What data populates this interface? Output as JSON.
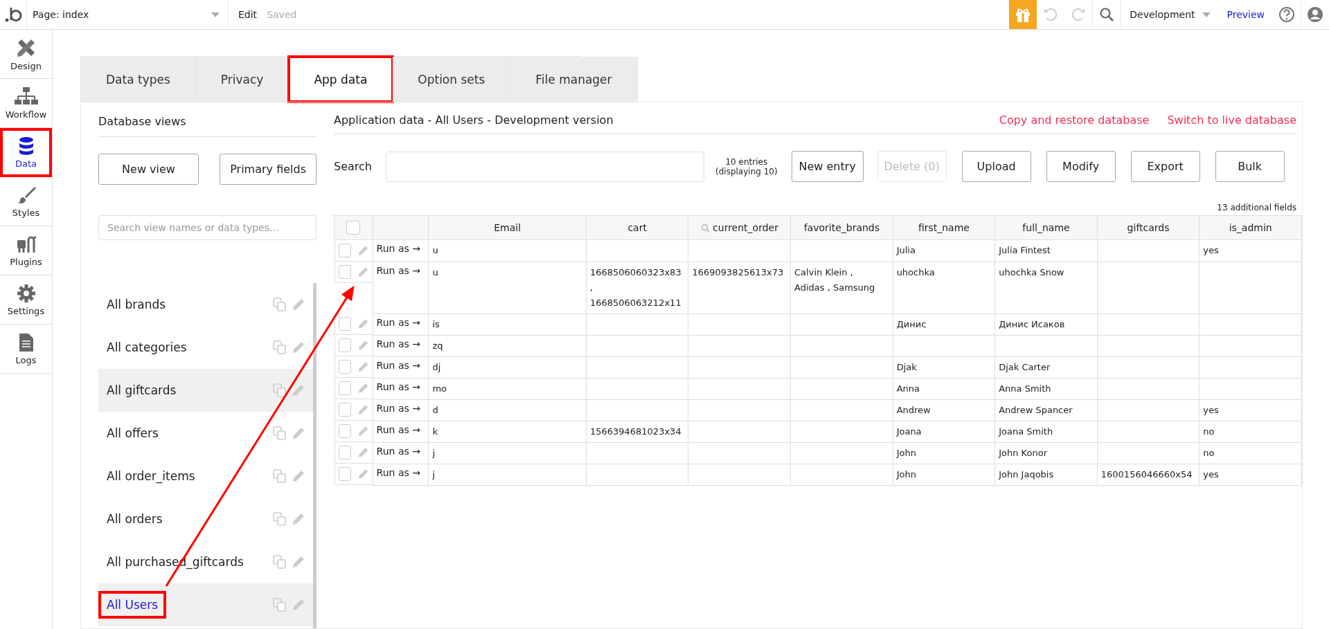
{
  "topbar": {
    "page_selector": "Page: index",
    "edit_label": "Edit",
    "save_status": "Saved",
    "version_selector": "Development",
    "preview_link": "Preview"
  },
  "nav": [
    {
      "label": "Design",
      "selected": false,
      "annotated": false
    },
    {
      "label": "Workflow",
      "selected": false,
      "annotated": false
    },
    {
      "label": "Data",
      "selected": true,
      "annotated": true
    },
    {
      "label": "Styles",
      "selected": false,
      "annotated": false
    },
    {
      "label": "Plugins",
      "selected": false,
      "annotated": false
    },
    {
      "label": "Settings",
      "selected": false,
      "annotated": false
    },
    {
      "label": "Logs",
      "selected": false,
      "annotated": false
    }
  ],
  "tabs": [
    {
      "label": "Data types",
      "selected": false,
      "annotated": false
    },
    {
      "label": "Privacy",
      "selected": false,
      "annotated": false
    },
    {
      "label": "App data",
      "selected": true,
      "annotated": true
    },
    {
      "label": "Option sets",
      "selected": false,
      "annotated": false
    },
    {
      "label": "File manager",
      "selected": false,
      "annotated": false
    }
  ],
  "database_views": {
    "title": "Database views",
    "buttons": [
      "New view",
      "Primary fields"
    ],
    "search": {
      "placeholder": "Search view names or data types..."
    },
    "items": [
      {
        "label": "All brands",
        "selected": false,
        "hovered": false,
        "annotated": false
      },
      {
        "label": "All categories",
        "selected": false,
        "hovered": false,
        "annotated": false
      },
      {
        "label": "All giftcards",
        "selected": false,
        "hovered": true,
        "annotated": false
      },
      {
        "label": "All offers",
        "selected": false,
        "hovered": false,
        "annotated": false
      },
      {
        "label": "All order_items",
        "selected": false,
        "hovered": false,
        "annotated": false
      },
      {
        "label": "All orders",
        "selected": false,
        "hovered": false,
        "annotated": false
      },
      {
        "label": "All purchased_giftcards",
        "selected": false,
        "hovered": false,
        "annotated": false
      },
      {
        "label": "All Users",
        "selected": true,
        "hovered": false,
        "annotated": true
      }
    ]
  },
  "app_data": {
    "title": "Application data - All Users - Development version",
    "links": [
      "Copy and restore database",
      "Switch to live database"
    ],
    "search_label": "Search",
    "entries": [
      "10 entries",
      "(displaying 10)"
    ],
    "buttons": [
      {
        "label": "New entry",
        "disabled": false
      },
      {
        "label": "Delete (0)",
        "disabled": true
      },
      {
        "label": "Upload",
        "disabled": false
      },
      {
        "label": "Modify",
        "disabled": false
      },
      {
        "label": "Export",
        "disabled": false
      },
      {
        "label": "Bulk",
        "disabled": false
      }
    ],
    "additional_fields": "13 additional fields",
    "table": {
      "columns": [
        {
          "label": "Email",
          "searchable": false
        },
        {
          "label": "cart",
          "searchable": false
        },
        {
          "label": "current_order",
          "searchable": true
        },
        {
          "label": "favorite_brands",
          "searchable": false
        },
        {
          "label": "first_name",
          "searchable": false
        },
        {
          "label": "full_name",
          "searchable": false
        },
        {
          "label": "giftcards",
          "searchable": false
        },
        {
          "label": "is_admin",
          "searchable": false
        }
      ],
      "header_checked": false,
      "rows": [
        {
          "checked": false,
          "run_as": "Run as →",
          "cells": [
            [
              "u"
            ],
            [],
            [],
            [],
            [
              "Julia"
            ],
            [
              "Julia Fintest"
            ],
            [],
            [
              "yes"
            ]
          ]
        },
        {
          "checked": false,
          "run_as": "Run as →",
          "cells": [
            [
              "u"
            ],
            [
              "1668506060323x83",
              ",",
              "1668506063212x11"
            ],
            [
              "1669093825613x73"
            ],
            [
              "Calvin Klein ,",
              "Adidas , Samsung"
            ],
            [
              "uhochka"
            ],
            [
              "uhochka Snow"
            ],
            [],
            []
          ]
        },
        {
          "checked": false,
          "run_as": "Run as →",
          "cells": [
            [
              "is"
            ],
            [],
            [],
            [],
            [
              "Динис"
            ],
            [
              "Динис Исаков"
            ],
            [],
            []
          ]
        },
        {
          "checked": false,
          "run_as": "Run as →",
          "cells": [
            [
              "zq"
            ],
            [],
            [],
            [],
            [],
            [],
            [],
            []
          ]
        },
        {
          "checked": false,
          "run_as": "Run as →",
          "cells": [
            [
              "dj"
            ],
            [],
            [],
            [],
            [
              "Djak"
            ],
            [
              "Djak Carter"
            ],
            [],
            []
          ]
        },
        {
          "checked": false,
          "run_as": "Run as →",
          "cells": [
            [
              "mo"
            ],
            [],
            [],
            [],
            [
              "Anna"
            ],
            [
              "Anna Smith"
            ],
            [],
            []
          ]
        },
        {
          "checked": false,
          "run_as": "Run as →",
          "cells": [
            [
              "d"
            ],
            [],
            [],
            [],
            [
              "Andrew"
            ],
            [
              "Andrew Spancer"
            ],
            [],
            [
              "yes"
            ]
          ]
        },
        {
          "checked": false,
          "run_as": "Run as →",
          "cells": [
            [
              "k"
            ],
            [
              "1566394681023x34"
            ],
            [],
            [],
            [
              "Joana"
            ],
            [
              "Joana Smith"
            ],
            [],
            [
              "no"
            ]
          ]
        },
        {
          "checked": false,
          "run_as": "Run as →",
          "cells": [
            [
              "j"
            ],
            [],
            [],
            [],
            [
              "John"
            ],
            [
              "John Konor"
            ],
            [],
            [
              "no"
            ]
          ]
        },
        {
          "checked": false,
          "run_as": "Run as →",
          "cells": [
            [
              "j"
            ],
            [],
            [],
            [],
            [
              "John"
            ],
            [
              "John Jaqobis"
            ],
            [
              "1600156046660x54"
            ],
            [
              "yes"
            ]
          ]
        }
      ]
    }
  }
}
